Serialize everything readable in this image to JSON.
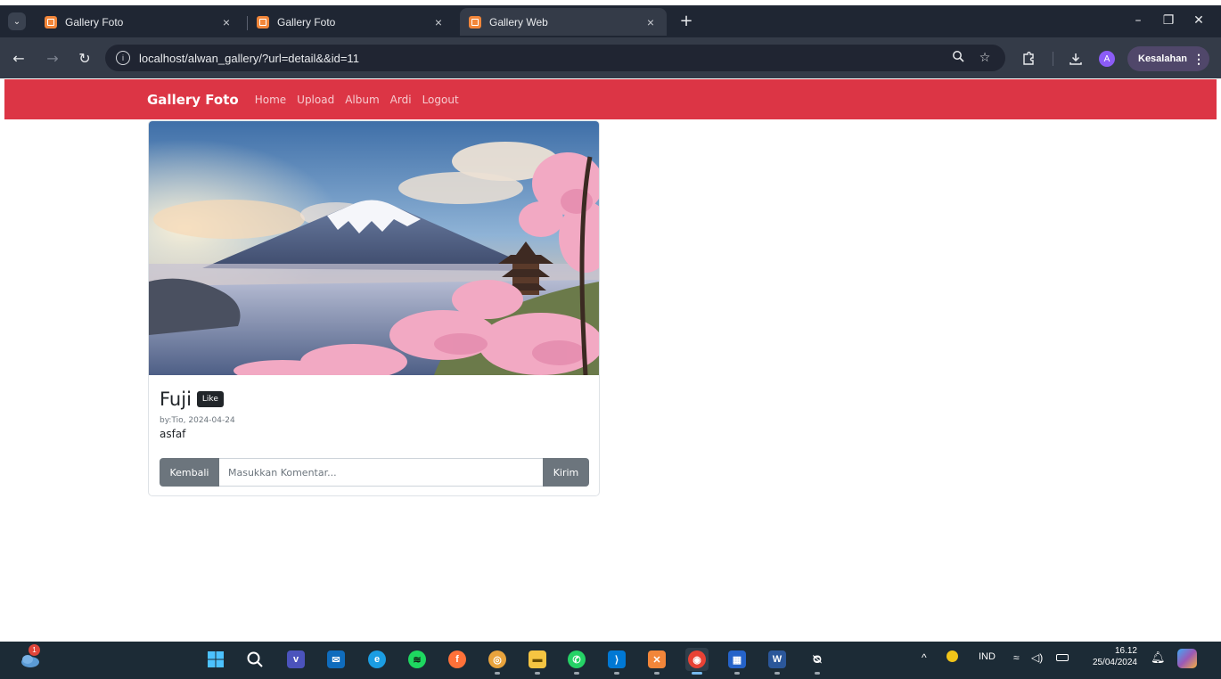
{
  "browser": {
    "tabs": [
      {
        "title": "Gallery Foto",
        "active": false
      },
      {
        "title": "Gallery Foto",
        "active": false
      },
      {
        "title": "Gallery Web",
        "active": true
      }
    ],
    "tab_close_glyph": "×",
    "new_tab_glyph": "+",
    "window_controls": {
      "minimize": "–",
      "restore": "❐",
      "close": "✕"
    },
    "url": "localhost/alwan_gallery/?url=detail&&id=11",
    "avatar_initial": "A",
    "error_button_label": "Kesalahan",
    "icons": [
      "tab-search-icon",
      "back-icon",
      "forward-icon",
      "reload-icon",
      "site-info-icon",
      "zoom-icon",
      "bookmark-star-icon",
      "extensions-icon",
      "download-icon",
      "kebab-menu-icon"
    ]
  },
  "navbar": {
    "brand": "Gallery Foto",
    "links": [
      "Home",
      "Upload",
      "Album",
      "Ardi",
      "Logout"
    ],
    "color": "#dc3545"
  },
  "photo_card": {
    "image_alt": "Mount Fuji with pagoda and cherry blossoms",
    "title": "Fuji",
    "like_label": "Like",
    "meta": "by:Tio, 2024-04-24",
    "description": "asfaf",
    "back_button": "Kembali",
    "comment_placeholder": "Masukkan Komentar...",
    "send_button": "Kirim"
  },
  "taskbar": {
    "weather_badge": "1",
    "apps": [
      "start",
      "search",
      "teams-meet",
      "mail",
      "edge",
      "spotify",
      "firefox",
      "chrome-dev",
      "file-explorer",
      "whatsapp",
      "vscode",
      "xampp",
      "chrome",
      "microsoft-store",
      "word",
      "copilot"
    ],
    "tray_language": "IND",
    "time": "16.12",
    "date": "25/04/2024"
  }
}
